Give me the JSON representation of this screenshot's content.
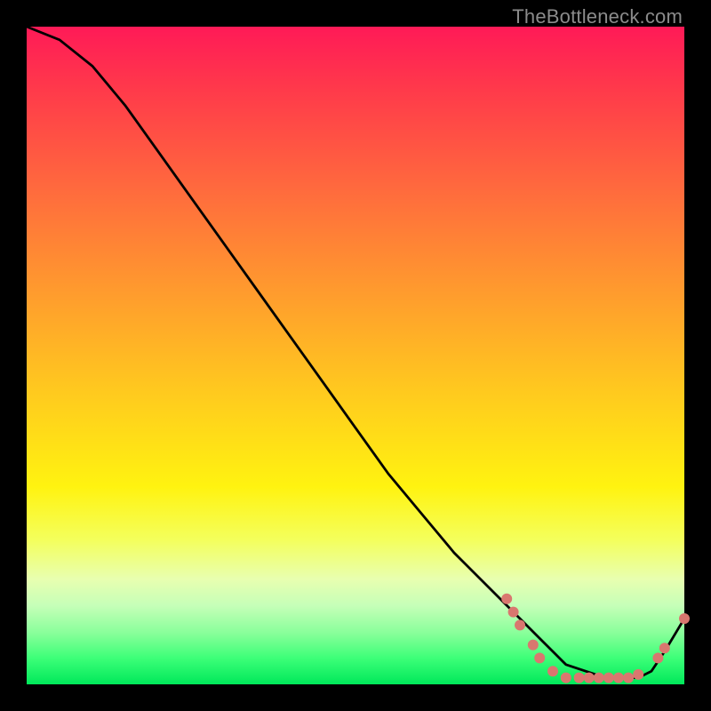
{
  "watermark": "TheBottleneck.com",
  "chart_data": {
    "type": "line",
    "title": "",
    "xlabel": "",
    "ylabel": "",
    "xlim": [
      0,
      100
    ],
    "ylim": [
      0,
      100
    ],
    "series": [
      {
        "name": "curve",
        "x": [
          0,
          5,
          10,
          15,
          20,
          25,
          30,
          35,
          40,
          45,
          50,
          55,
          60,
          65,
          70,
          75,
          78,
          80,
          82,
          85,
          88,
          90,
          93,
          95,
          97,
          100
        ],
        "y": [
          100,
          98,
          94,
          88,
          81,
          74,
          67,
          60,
          53,
          46,
          39,
          32,
          26,
          20,
          15,
          10,
          7,
          5,
          3,
          2,
          1,
          1,
          1,
          2,
          5,
          10
        ]
      }
    ],
    "markers": [
      {
        "x": 73,
        "y": 13
      },
      {
        "x": 74,
        "y": 11
      },
      {
        "x": 75,
        "y": 9
      },
      {
        "x": 77,
        "y": 6
      },
      {
        "x": 78,
        "y": 4
      },
      {
        "x": 80,
        "y": 2
      },
      {
        "x": 82,
        "y": 1
      },
      {
        "x": 84,
        "y": 1
      },
      {
        "x": 85.5,
        "y": 1
      },
      {
        "x": 87,
        "y": 1
      },
      {
        "x": 88.5,
        "y": 1
      },
      {
        "x": 90,
        "y": 1
      },
      {
        "x": 91.5,
        "y": 1
      },
      {
        "x": 93,
        "y": 1.5
      },
      {
        "x": 96,
        "y": 4
      },
      {
        "x": 97,
        "y": 5.5
      },
      {
        "x": 100,
        "y": 10
      }
    ],
    "marker_color": "#d9776f",
    "line_color": "#000000"
  }
}
